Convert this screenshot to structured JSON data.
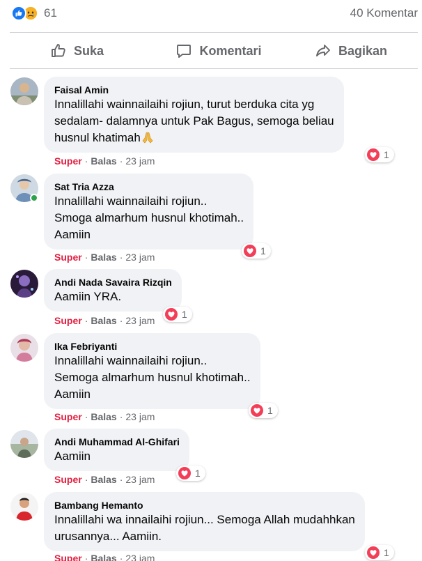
{
  "post": {
    "reaction_count": "61",
    "comment_count": "40 Komentar",
    "reaction_icons": [
      "like-icon",
      "sad-icon"
    ]
  },
  "actions": {
    "like": "Suka",
    "comment": "Komentari",
    "share": "Bagikan"
  },
  "colors": {
    "link_blue": "#1877f2",
    "super_red": "#e41e3f",
    "bubble_bg": "#f0f2f5",
    "muted": "#65676b",
    "online_green": "#31a24c"
  },
  "comments": [
    {
      "name": "Faisal Amin",
      "lines": [
        "Innalillahi wainnailaihi rojiun, turut berduka cita yg",
        "sedalam- dalamnya untuk Pak Bagus, semoga beliau",
        "husnul khatimah"
      ],
      "emoji": "folded-hands-icon",
      "reaction_count": "1",
      "reaction": "Super",
      "reply": "Balas",
      "separator": "·",
      "time": "23 jam"
    },
    {
      "name": "Sat Tria Azza",
      "lines": [
        "Innalillahi wainnailaihi rojiun..",
        "Smoga almarhum husnul khotimah..",
        "Aamiin"
      ],
      "reaction_count": "1",
      "reaction": "Super",
      "reply": "Balas",
      "separator": "·",
      "time": "23 jam"
    },
    {
      "name": "Andi Nada Savaira Rizqin",
      "lines": [
        "Aamiin YRA."
      ],
      "reaction_count": "1",
      "reaction": "Super",
      "reply": "Balas",
      "separator": "·",
      "time": "23 jam"
    },
    {
      "name": "Ika Febriyanti",
      "lines": [
        "Innalillahi wainnailaihi rojiun..",
        "Semoga almarhum husnul khotimah..",
        "Aamiin"
      ],
      "reaction_count": "1",
      "reaction": "Super",
      "reply": "Balas",
      "separator": "·",
      "time": "23 jam"
    },
    {
      "name": "Andi Muhammad Al-Ghifari",
      "lines": [
        "Aamiin"
      ],
      "reaction_count": "1",
      "reaction": "Super",
      "reply": "Balas",
      "separator": "·",
      "time": "23 jam"
    },
    {
      "name": "Bambang Hemanto",
      "lines": [
        "Innalillahi wa innailaihi rojiun... Semoga Allah mudahhkan",
        "urusannya... Aamiin."
      ],
      "reaction_count": "1",
      "reaction": "Super",
      "reply": "Balas",
      "separator": "·",
      "time": "23 jam"
    }
  ]
}
